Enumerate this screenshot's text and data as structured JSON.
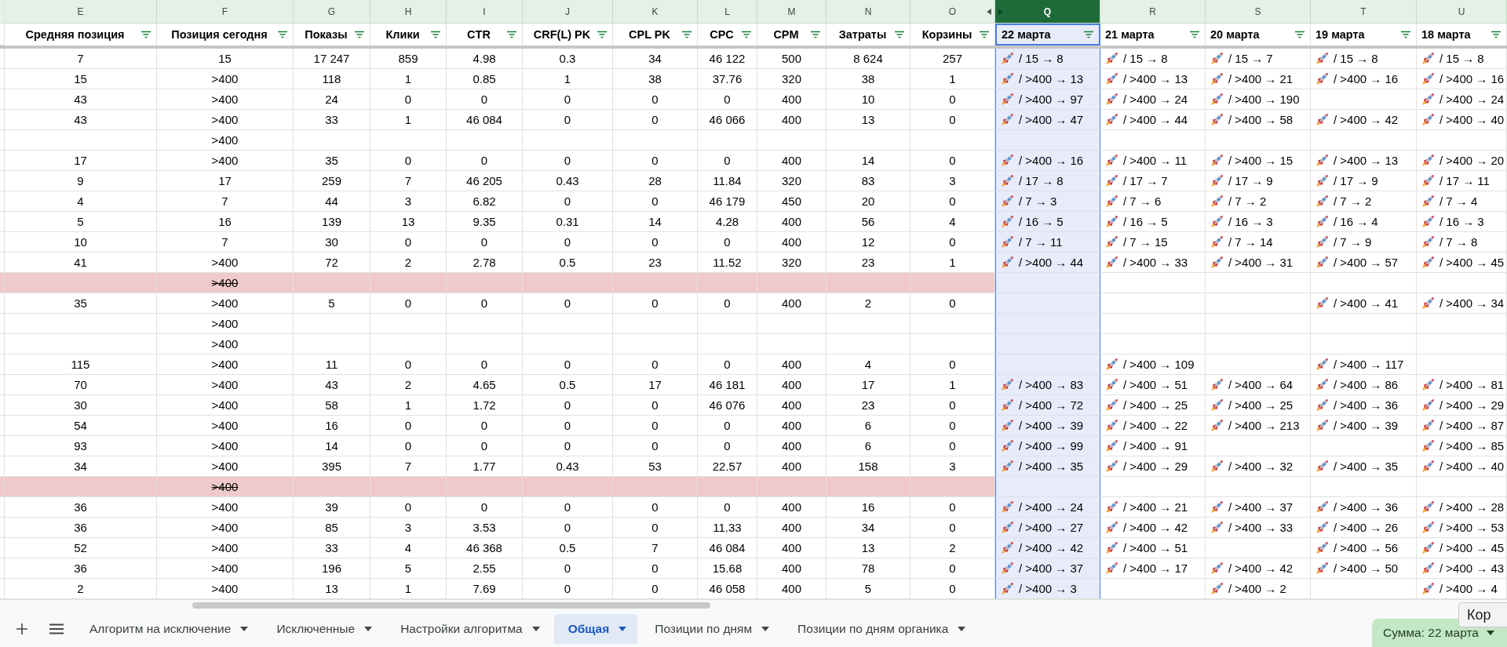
{
  "columns": [
    {
      "letter": "E",
      "title": "Средняя позиция",
      "selected": false
    },
    {
      "letter": "F",
      "title": "Позиция сегодня",
      "selected": false
    },
    {
      "letter": "G",
      "title": "Показы",
      "selected": false
    },
    {
      "letter": "H",
      "title": "Клики",
      "selected": false
    },
    {
      "letter": "I",
      "title": "CTR",
      "selected": false
    },
    {
      "letter": "J",
      "title": "CRF(L) PK",
      "selected": false
    },
    {
      "letter": "K",
      "title": "CPL PK",
      "selected": false
    },
    {
      "letter": "L",
      "title": "CPC",
      "selected": false
    },
    {
      "letter": "M",
      "title": "CPM",
      "selected": false
    },
    {
      "letter": "N",
      "title": "Затраты",
      "selected": false
    },
    {
      "letter": "O",
      "title": "Корзины",
      "selected": false
    },
    {
      "letter": "Q",
      "title": "22 марта",
      "selected": true
    },
    {
      "letter": "R",
      "title": "21 марта",
      "selected": false
    },
    {
      "letter": "S",
      "title": "20 марта",
      "selected": false
    },
    {
      "letter": "T",
      "title": "19 марта",
      "selected": false
    },
    {
      "letter": "U",
      "title": "18 марта",
      "selected": false
    }
  ],
  "rows": [
    {
      "excluded": false,
      "cells": {
        "E": "7",
        "F": "15",
        "G": "17 247",
        "H": "859",
        "I": "4.98",
        "J": "0.3",
        "K": "34",
        "L": "46 122",
        "M": "500",
        "N": "8 624",
        "O": "257",
        "Q": "/ 15 → 8",
        "R": "/ 15 → 8",
        "S": "/ 15 → 7",
        "T": "/ 15 → 8",
        "U": "/ 15 → 8"
      }
    },
    {
      "excluded": false,
      "cells": {
        "E": "15",
        "F": ">400",
        "G": "118",
        "H": "1",
        "I": "0.85",
        "J": "1",
        "K": "38",
        "L": "37.76",
        "M": "320",
        "N": "38",
        "O": "1",
        "Q": "/ >400 → 13",
        "R": "/ >400 → 13",
        "S": "/ >400 → 21",
        "T": "/ >400 → 16",
        "U": "/ >400 → 16"
      }
    },
    {
      "excluded": false,
      "cells": {
        "E": "43",
        "F": ">400",
        "G": "24",
        "H": "0",
        "I": "0",
        "J": "0",
        "K": "0",
        "L": "0",
        "M": "400",
        "N": "10",
        "O": "0",
        "Q": "/ >400 → 97",
        "R": "/ >400 → 24",
        "S": "/ >400 → 190",
        "U": "/ >400 → 24"
      }
    },
    {
      "excluded": false,
      "cells": {
        "E": "43",
        "F": ">400",
        "G": "33",
        "H": "1",
        "I": "46 084",
        "J": "0",
        "K": "0",
        "L": "46 066",
        "M": "400",
        "N": "13",
        "O": "0",
        "Q": "/ >400 → 47",
        "R": "/ >400 → 44",
        "S": "/ >400 → 58",
        "T": "/ >400 → 42",
        "U": "/ >400 → 40"
      }
    },
    {
      "excluded": false,
      "cells": {
        "F": ">400"
      }
    },
    {
      "excluded": false,
      "cells": {
        "E": "17",
        "F": ">400",
        "G": "35",
        "H": "0",
        "I": "0",
        "J": "0",
        "K": "0",
        "L": "0",
        "M": "400",
        "N": "14",
        "O": "0",
        "Q": "/ >400 → 16",
        "R": "/ >400 → 11",
        "S": "/ >400 → 15",
        "T": "/ >400 → 13",
        "U": "/ >400 → 20"
      }
    },
    {
      "excluded": false,
      "cells": {
        "E": "9",
        "F": "17",
        "G": "259",
        "H": "7",
        "I": "46 205",
        "J": "0.43",
        "K": "28",
        "L": "11.84",
        "M": "320",
        "N": "83",
        "O": "3",
        "Q": "/ 17 → 8",
        "R": "/ 17 → 7",
        "S": "/ 17 → 9",
        "T": "/ 17 → 9",
        "U": "/ 17 → 11"
      }
    },
    {
      "excluded": false,
      "cells": {
        "E": "4",
        "F": "7",
        "G": "44",
        "H": "3",
        "I": "6.82",
        "J": "0",
        "K": "0",
        "L": "46 179",
        "M": "450",
        "N": "20",
        "O": "0",
        "Q": "/ 7 → 3",
        "R": "/ 7 → 6",
        "S": "/ 7 → 2",
        "T": "/ 7 → 2",
        "U": "/ 7 → 4"
      }
    },
    {
      "excluded": false,
      "cells": {
        "E": "5",
        "F": "16",
        "G": "139",
        "H": "13",
        "I": "9.35",
        "J": "0.31",
        "K": "14",
        "L": "4.28",
        "M": "400",
        "N": "56",
        "O": "4",
        "Q": "/ 16 → 5",
        "R": "/ 16 → 5",
        "S": "/ 16 → 3",
        "T": "/ 16 → 4",
        "U": "/ 16 → 3"
      }
    },
    {
      "excluded": false,
      "cells": {
        "E": "10",
        "F": "7",
        "G": "30",
        "H": "0",
        "I": "0",
        "J": "0",
        "K": "0",
        "L": "0",
        "M": "400",
        "N": "12",
        "O": "0",
        "Q": "/ 7 → 11",
        "R": "/ 7 → 15",
        "S": "/ 7 → 14",
        "T": "/ 7 → 9",
        "U": "/ 7 → 8"
      }
    },
    {
      "excluded": false,
      "cells": {
        "E": "41",
        "F": ">400",
        "G": "72",
        "H": "2",
        "I": "2.78",
        "J": "0.5",
        "K": "23",
        "L": "11.52",
        "M": "320",
        "N": "23",
        "O": "1",
        "Q": "/ >400 → 44",
        "R": "/ >400 → 33",
        "S": "/ >400 → 31",
        "T": "/ >400 → 57",
        "U": "/ >400 → 45"
      }
    },
    {
      "excluded": true,
      "cells": {
        "F": ">400"
      }
    },
    {
      "excluded": false,
      "cells": {
        "E": "35",
        "F": ">400",
        "G": "5",
        "H": "0",
        "I": "0",
        "J": "0",
        "K": "0",
        "L": "0",
        "M": "400",
        "N": "2",
        "O": "0",
        "T": "/ >400 → 41",
        "U": "/ >400 → 34"
      }
    },
    {
      "excluded": false,
      "cells": {
        "F": ">400"
      }
    },
    {
      "excluded": false,
      "cells": {
        "F": ">400"
      }
    },
    {
      "excluded": false,
      "cells": {
        "E": "115",
        "F": ">400",
        "G": "11",
        "H": "0",
        "I": "0",
        "J": "0",
        "K": "0",
        "L": "0",
        "M": "400",
        "N": "4",
        "O": "0",
        "R": "/ >400 → 109",
        "T": "/ >400 → 117"
      }
    },
    {
      "excluded": false,
      "cells": {
        "E": "70",
        "F": ">400",
        "G": "43",
        "H": "2",
        "I": "4.65",
        "J": "0.5",
        "K": "17",
        "L": "46 181",
        "M": "400",
        "N": "17",
        "O": "1",
        "Q": "/ >400 → 83",
        "R": "/ >400 → 51",
        "S": "/ >400 → 64",
        "T": "/ >400 → 86",
        "U": "/ >400 → 81"
      }
    },
    {
      "excluded": false,
      "cells": {
        "E": "30",
        "F": ">400",
        "G": "58",
        "H": "1",
        "I": "1.72",
        "J": "0",
        "K": "0",
        "L": "46 076",
        "M": "400",
        "N": "23",
        "O": "0",
        "Q": "/ >400 → 72",
        "R": "/ >400 → 25",
        "S": "/ >400 → 25",
        "T": "/ >400 → 36",
        "U": "/ >400 → 29"
      }
    },
    {
      "excluded": false,
      "cells": {
        "E": "54",
        "F": ">400",
        "G": "16",
        "H": "0",
        "I": "0",
        "J": "0",
        "K": "0",
        "L": "0",
        "M": "400",
        "N": "6",
        "O": "0",
        "Q": "/ >400 → 39",
        "R": "/ >400 → 22",
        "S": "/ >400 → 213",
        "T": "/ >400 → 39",
        "U": "/ >400 → 87"
      }
    },
    {
      "excluded": false,
      "cells": {
        "E": "93",
        "F": ">400",
        "G": "14",
        "H": "0",
        "I": "0",
        "J": "0",
        "K": "0",
        "L": "0",
        "M": "400",
        "N": "6",
        "O": "0",
        "Q": "/ >400 → 99",
        "R": "/ >400 → 91",
        "U": "/ >400 → 85"
      }
    },
    {
      "excluded": false,
      "cells": {
        "E": "34",
        "F": ">400",
        "G": "395",
        "H": "7",
        "I": "1.77",
        "J": "0.43",
        "K": "53",
        "L": "22.57",
        "M": "400",
        "N": "158",
        "O": "3",
        "Q": "/ >400 → 35",
        "R": "/ >400 → 29",
        "S": "/ >400 → 32",
        "T": "/ >400 → 35",
        "U": "/ >400 → 40"
      }
    },
    {
      "excluded": true,
      "cells": {
        "F": ">400"
      }
    },
    {
      "excluded": false,
      "cells": {
        "E": "36",
        "F": ">400",
        "G": "39",
        "H": "0",
        "I": "0",
        "J": "0",
        "K": "0",
        "L": "0",
        "M": "400",
        "N": "16",
        "O": "0",
        "Q": "/ >400 → 24",
        "R": "/ >400 → 21",
        "S": "/ >400 → 37",
        "T": "/ >400 → 36",
        "U": "/ >400 → 28"
      }
    },
    {
      "excluded": false,
      "cells": {
        "E": "36",
        "F": ">400",
        "G": "85",
        "H": "3",
        "I": "3.53",
        "J": "0",
        "K": "0",
        "L": "11.33",
        "M": "400",
        "N": "34",
        "O": "0",
        "Q": "/ >400 → 27",
        "R": "/ >400 → 42",
        "S": "/ >400 → 33",
        "T": "/ >400 → 26",
        "U": "/ >400 → 53"
      }
    },
    {
      "excluded": false,
      "cells": {
        "E": "52",
        "F": ">400",
        "G": "33",
        "H": "4",
        "I": "46 368",
        "J": "0.5",
        "K": "7",
        "L": "46 084",
        "M": "400",
        "N": "13",
        "O": "2",
        "Q": "/ >400 → 42",
        "R": "/ >400 → 51",
        "T": "/ >400 → 56",
        "U": "/ >400 → 45"
      }
    },
    {
      "excluded": false,
      "cells": {
        "E": "36",
        "F": ">400",
        "G": "196",
        "H": "5",
        "I": "2.55",
        "J": "0",
        "K": "0",
        "L": "15.68",
        "M": "400",
        "N": "78",
        "O": "0",
        "Q": "/ >400 → 37",
        "R": "/ >400 → 17",
        "S": "/ >400 → 42",
        "T": "/ >400 → 50",
        "U": "/ >400 → 43"
      }
    },
    {
      "excluded": false,
      "cells": {
        "E": "2",
        "F": ">400",
        "G": "13",
        "H": "1",
        "I": "7.69",
        "J": "0",
        "K": "0",
        "L": "46 058",
        "M": "400",
        "N": "5",
        "O": "0",
        "Q": "/ >400 → 3",
        "S": "/ >400 → 2",
        "U": "/ >400 → 4"
      }
    }
  ],
  "sheet_tabs": [
    {
      "label": "Алгоритм на исключение",
      "selected": false
    },
    {
      "label": "Исключенные",
      "selected": false
    },
    {
      "label": "Настройки алгоритма",
      "selected": false
    },
    {
      "label": "Общая",
      "selected": true
    },
    {
      "label": "Позиции по дням",
      "selected": false
    },
    {
      "label": "Позиции по дням органика",
      "selected": false
    }
  ],
  "sum_button": {
    "label": "Сумма: 22 марта"
  },
  "tooltip": {
    "text": "Кор"
  }
}
